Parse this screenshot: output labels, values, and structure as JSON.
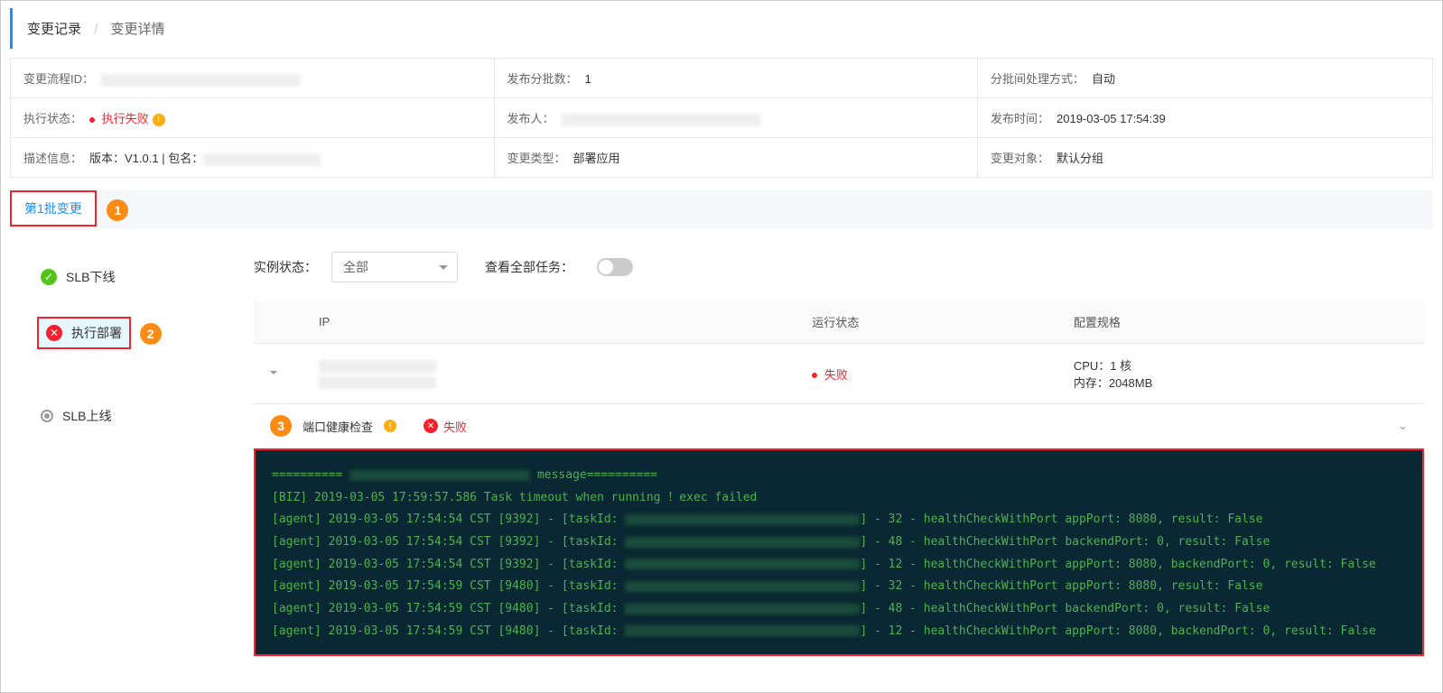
{
  "breadcrumb": {
    "item1": "变更记录",
    "item2": "变更详情"
  },
  "info": {
    "r1c1_label": "变更流程ID：",
    "r1c1_val": "",
    "r1c2_label": "发布分批数：",
    "r1c2_val": "1",
    "r1c3_label": "分批间处理方式：",
    "r1c3_val": "自动",
    "r2c1_label": "执行状态：",
    "r2c1_val": "执行失败",
    "r2c2_label": "发布人：",
    "r2c2_val": "",
    "r2c3_label": "发布时间：",
    "r2c3_val": "2019-03-05 17:54:39",
    "r3c1_label": "描述信息：",
    "r3c1_val_prefix": "版本：V1.0.1 | 包名：",
    "r3c2_label": "变更类型：",
    "r3c2_val": "部署应用",
    "r3c3_label": "变更对象：",
    "r3c3_val": "默认分组"
  },
  "annotations": {
    "a1": "1",
    "a2": "2",
    "a3": "3"
  },
  "tab": {
    "label": "第1批变更"
  },
  "steps": {
    "s1": "SLB下线",
    "s2": "执行部署",
    "s3": "SLB上线"
  },
  "filter": {
    "state_label": "实例状态：",
    "state_val": "全部",
    "view_all_label": "查看全部任务："
  },
  "table": {
    "col_ip": "IP",
    "col_run": "运行状态",
    "col_spec": "配置规格",
    "row1": {
      "run_status": "失败",
      "spec1": "CPU：1 核",
      "spec2": "内存：2048MB"
    }
  },
  "health": {
    "title": "端口健康检查",
    "fail": "失败"
  },
  "console": {
    "l1a": "==========",
    "l1b": " message==========",
    "l2": "[BIZ] 2019-03-05 17:59:57.586 Task timeout when running ！exec failed",
    "l3a": "[agent] 2019-03-05 17:54:54 CST [9392] - [taskId: ",
    "l3b": "] - 32 - healthCheckWithPort appPort: 8080, result: False",
    "l4a": "[agent] 2019-03-05 17:54:54 CST [9392] - [taskId: ",
    "l4b": "] - 48 - healthCheckWithPort backendPort: 0, result: False",
    "l5a": "[agent] 2019-03-05 17:54:54 CST [9392] - [taskId: ",
    "l5b": "] - 12 - healthCheckWithPort appPort: 8080, backendPort: 0, result: False",
    "l6a": "[agent] 2019-03-05 17:54:59 CST [9480] - [taskId: ",
    "l6b": "] - 32 - healthCheckWithPort appPort: 8080, result: False",
    "l7a": "[agent] 2019-03-05 17:54:59 CST [9480] - [taskId: ",
    "l7b": "] - 48 - healthCheckWithPort backendPort: 0, result: False",
    "l8a": "[agent] 2019-03-05 17:54:59 CST [9480] - [taskId: ",
    "l8b": "] - 12 - healthCheckWithPort appPort: 8080, backendPort: 0, result: False"
  }
}
